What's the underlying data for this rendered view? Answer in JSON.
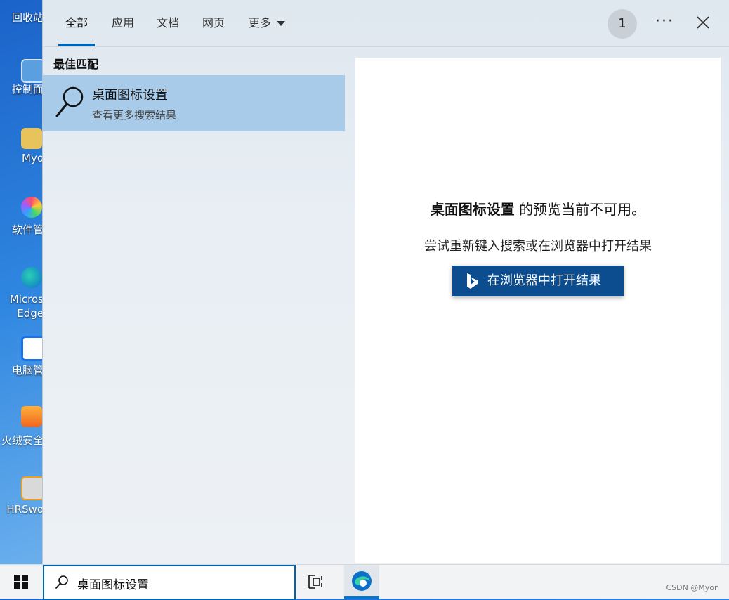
{
  "desktop": {
    "icons": [
      {
        "label": "回收站",
        "icon": "recycle-bin-icon"
      },
      {
        "label": "控制面",
        "icon": "control-panel-icon"
      },
      {
        "label": "Myo",
        "icon": "user-folder-icon"
      },
      {
        "label": "软件管",
        "icon": "software-manager-icon"
      },
      {
        "label": "Micros Edge",
        "icon": "edge-icon"
      },
      {
        "label": "电脑管",
        "icon": "pc-manager-icon"
      },
      {
        "label": "火绒安全",
        "icon": "huorong-icon"
      },
      {
        "label": "HRSwo",
        "icon": "hrsword-icon"
      }
    ]
  },
  "search_panel": {
    "tabs": [
      "全部",
      "应用",
      "文档",
      "网页",
      "更多"
    ],
    "active_tab": "全部",
    "badge_count": "1",
    "section_title": "最佳匹配",
    "best_match": {
      "title": "桌面图标设置",
      "subtitle": "查看更多搜索结果"
    },
    "preview": {
      "term": "桌面图标设置",
      "message_suffix": " 的预览当前不可用。",
      "hint": "尝试重新键入搜索或在浏览器中打开结果",
      "button_label": "在浏览器中打开结果"
    }
  },
  "taskbar": {
    "search_value": "桌面图标设置",
    "watermark": "CSDN @Myon⁠⁠",
    "accent": "#0063b1"
  }
}
